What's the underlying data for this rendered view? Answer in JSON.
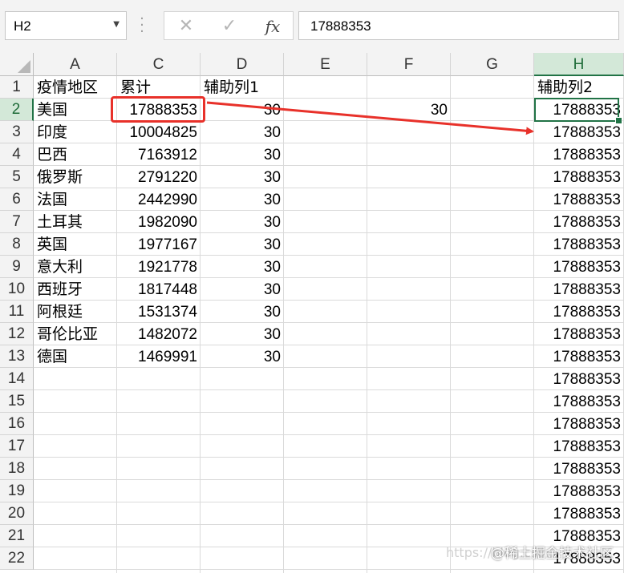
{
  "name_box": {
    "value": "H2"
  },
  "formula_bar": {
    "value": "17888353",
    "fx_label": "fx"
  },
  "columns": [
    "A",
    "C",
    "D",
    "E",
    "F",
    "G",
    "H"
  ],
  "rows": [
    "1",
    "2",
    "3",
    "4",
    "5",
    "6",
    "7",
    "8",
    "9",
    "10",
    "11",
    "12",
    "13",
    "14",
    "15",
    "16",
    "17",
    "18",
    "19",
    "20",
    "21",
    "22"
  ],
  "table": {
    "headers": {
      "a": "疫情地区",
      "c": "累计",
      "d": "辅助列1",
      "h": "辅助列2"
    },
    "f2": "30",
    "data": [
      {
        "a": "美国",
        "c": "17888353",
        "d": "30"
      },
      {
        "a": "印度",
        "c": "10004825",
        "d": "30"
      },
      {
        "a": "巴西",
        "c": "7163912",
        "d": "30"
      },
      {
        "a": "俄罗斯",
        "c": "2791220",
        "d": "30"
      },
      {
        "a": "法国",
        "c": "2442990",
        "d": "30"
      },
      {
        "a": "土耳其",
        "c": "1982090",
        "d": "30"
      },
      {
        "a": "英国",
        "c": "1977167",
        "d": "30"
      },
      {
        "a": "意大利",
        "c": "1921778",
        "d": "30"
      },
      {
        "a": "西班牙",
        "c": "1817448",
        "d": "30"
      },
      {
        "a": "阿根廷",
        "c": "1531374",
        "d": "30"
      },
      {
        "a": "哥伦比亚",
        "c": "1482072",
        "d": "30"
      },
      {
        "a": "德国",
        "c": "1469991",
        "d": "30"
      }
    ],
    "h_values": [
      "17888353",
      "17888353",
      "17888353",
      "17888353",
      "17888353",
      "17888353",
      "17888353",
      "17888353",
      "17888353",
      "17888353",
      "17888353",
      "17888353",
      "17888353",
      "17888353",
      "17888353",
      "17888353",
      "17888353",
      "17888353",
      "17888353",
      "17888353",
      "17888353"
    ]
  },
  "annotation": {
    "color": "#e8312a"
  },
  "watermark": {
    "url_text": "https://blog.csdn",
    "site": "@稀土掘金技术社区"
  }
}
